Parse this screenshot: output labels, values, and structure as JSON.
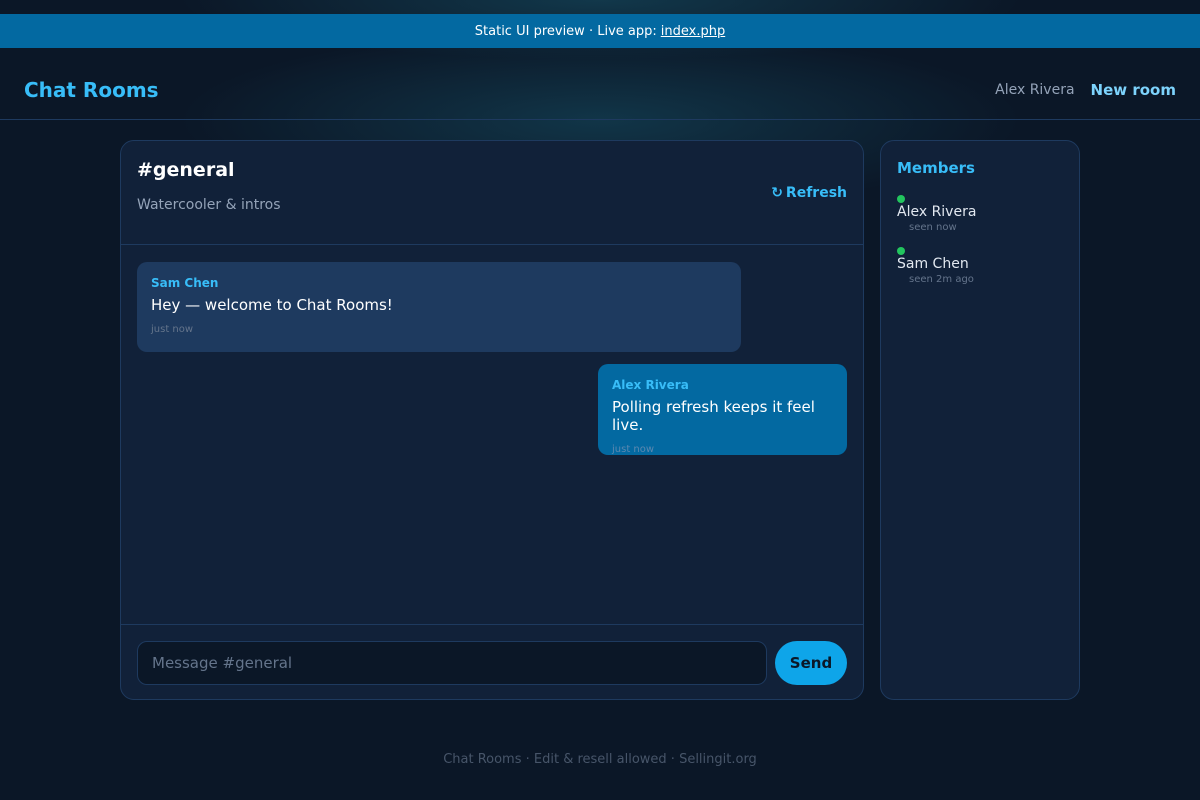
{
  "banner": {
    "text": "Static UI preview · Live app:",
    "link_label": "index.php"
  },
  "header": {
    "brand": "Chat Rooms",
    "user_name": "Alex Rivera",
    "new_room_label": "New room"
  },
  "room": {
    "name": "#general",
    "description": "Watercooler & intros",
    "refresh_icon": "↻",
    "refresh_label": "Refresh"
  },
  "messages": [
    {
      "author": "Sam Chen",
      "text": "Hey — welcome to Chat Rooms!",
      "time": "just now",
      "direction": "incoming"
    },
    {
      "author": "Alex Rivera",
      "text": "Polling refresh keeps it feel live.",
      "time": "just now",
      "direction": "outgoing"
    }
  ],
  "composer": {
    "placeholder": "Message #general",
    "value": "",
    "send_label": "Send"
  },
  "members": {
    "title": "Members",
    "items": [
      {
        "name": "Alex Rivera",
        "seen": "seen now",
        "status_color": "#22c55e"
      },
      {
        "name": "Sam Chen",
        "seen": "seen 2m ago",
        "status_color": "#22c55e"
      }
    ]
  },
  "footer": {
    "text": "Chat Rooms · Edit & resell allowed · Sellingit.org"
  },
  "colors": {
    "accent": "#38bdf8",
    "banner": "#0369a1",
    "background": "#0b1727",
    "panel": "#112139",
    "online": "#22c55e"
  }
}
